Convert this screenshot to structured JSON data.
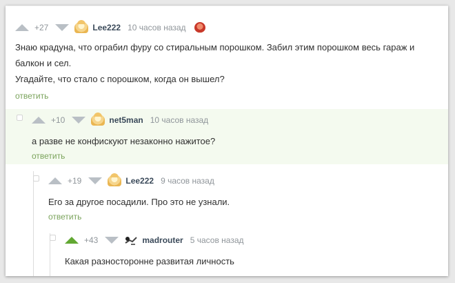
{
  "comments": [
    {
      "rating": "+27",
      "author": "Lee222",
      "time": "10 часов назад",
      "text_lines": [
        "Знаю крадуна, что ограбил фуру со стиральным порошком. Забил этим порошком весь гараж и",
        "балкон и сел.",
        "Угадайте, что стало с порошком, когда он вышел?"
      ],
      "reply": "ответить"
    },
    {
      "rating": "+10",
      "author": "net5man",
      "time": "10 часов назад",
      "text_lines": [
        "а разве не конфискуют незаконно нажитое?"
      ],
      "reply": "ответить"
    },
    {
      "rating": "+19",
      "author": "Lee222",
      "time": "9 часов назад",
      "text_lines": [
        "Его за другое посадили. Про это не узнали."
      ],
      "reply": "ответить"
    },
    {
      "rating": "+43",
      "author": "madrouter",
      "time": "5 часов назад",
      "text_lines": [
        "Какая разносторонне развитая личность"
      ]
    }
  ],
  "colors": {
    "upvote_active": "#62a833",
    "vote_inactive": "#b9bfc5",
    "reply_link": "#7aa35b",
    "highlight_bg": "#f4faef"
  },
  "icons": [
    "arrow-up-icon",
    "arrow-down-icon",
    "avatar-icon",
    "heart-badge-icon",
    "collapse-icon"
  ]
}
